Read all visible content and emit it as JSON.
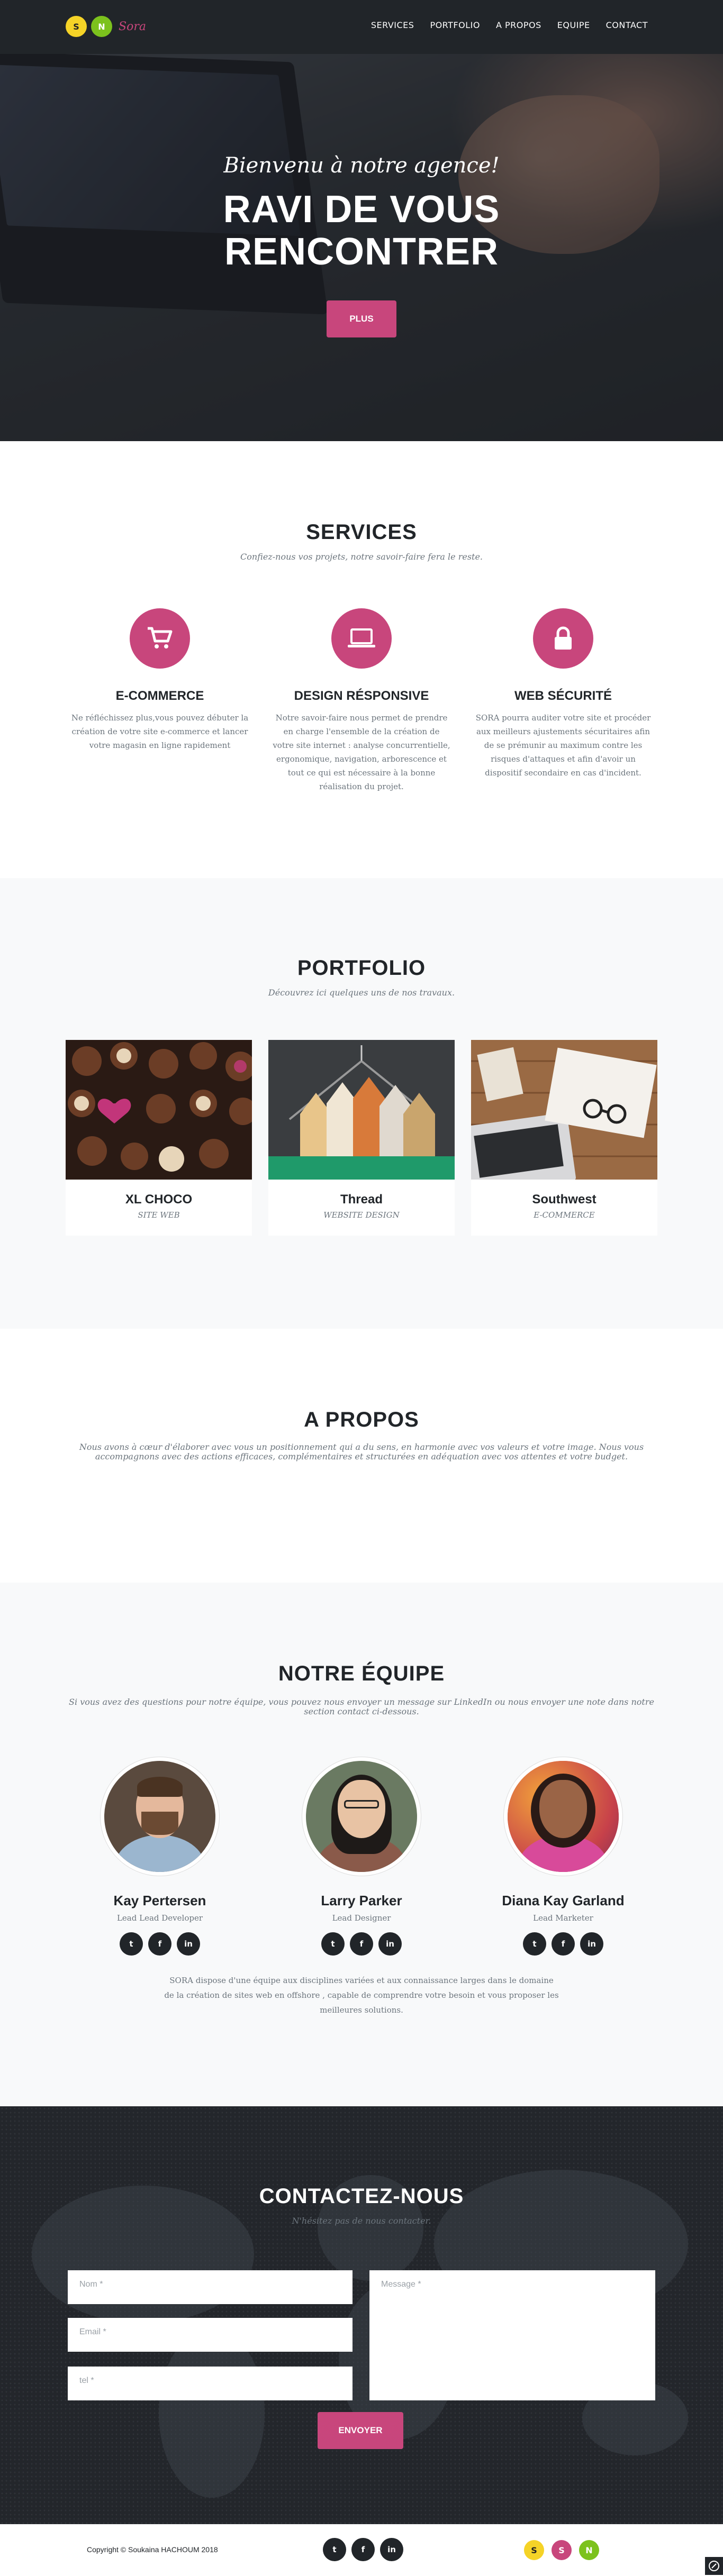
{
  "nav": {
    "brand_letters": [
      "S",
      "N"
    ],
    "brand_name": "Sora",
    "links": [
      "SERVICES",
      "PORTFOLIO",
      "A PROPOS",
      "EQUIPE",
      "CONTACT"
    ]
  },
  "hero": {
    "lead": "Bienvenu à notre agence!",
    "title_line1": "RAVI DE VOUS",
    "title_line2": "RENCONTRER",
    "button": "PLUS"
  },
  "services": {
    "heading": "SERVICES",
    "subheading": "Confiez-nous vos projets, notre savoir-faire fera le reste.",
    "items": [
      {
        "icon": "shopping-cart-icon",
        "title": "E-COMMERCE",
        "text": "Ne réfléchissez plus,vous pouvez débuter la création de votre site e-commerce et lancer votre magasin en ligne rapidement"
      },
      {
        "icon": "laptop-icon",
        "title": "DESIGN RÉSPONSIVE",
        "text": "Notre savoir-faire nous permet de prendre en charge l'ensemble de la création de votre site internet : analyse concurrentielle, ergonomique, navigation, arborescence et tout ce qui est nécessaire à la bonne réalisation du projet."
      },
      {
        "icon": "lock-icon",
        "title": "WEB SÉCURITÉ",
        "text": "SORA pourra auditer votre site et procéder aux meilleurs ajustements sécuritaires afin de se prémunir au maximum contre les risques d'attaques et afin d'avoir un dispositif secondaire en cas d'incident."
      }
    ]
  },
  "portfolio": {
    "heading": "PORTFOLIO",
    "subheading": "Découvrez ici quelques uns de nos travaux.",
    "items": [
      {
        "title": "XL CHOCO",
        "category": "SITE WEB"
      },
      {
        "title": "Thread",
        "category": "WEBSITE DESIGN"
      },
      {
        "title": "Southwest",
        "category": "E-COMMERCE"
      }
    ]
  },
  "about": {
    "heading": "A PROPOS",
    "text": "Nous avons à cœur d'élaborer avec vous un positionnement qui a du sens, en harmonie avec vos valeurs et votre image. Nous vous accompagnons avec des actions efficaces, complémentaires et structurées en adéquation avec vos attentes et votre budget."
  },
  "team": {
    "heading": "NOTRE ÉQUIPE",
    "subheading": "Si vous avez des questions pour notre équipe, vous pouvez nous envoyer un message sur LinkedIn ou nous envoyer une note dans notre section contact ci-dessous.",
    "members": [
      {
        "name": "Kay Pertersen",
        "role": "Lead Lead Developer"
      },
      {
        "name": "Larry Parker",
        "role": "Lead Designer"
      },
      {
        "name": "Diana Kay Garland",
        "role": "Lead Marketer"
      }
    ],
    "description": "SORA dispose d'une équipe aux disciplines variées et aux connaissance larges dans le domaine de la création de sites web en offshore , capable de comprendre votre besoin et vous proposer les meilleures solutions."
  },
  "social_glyphs": {
    "twitter": "t",
    "facebook": "f",
    "linkedin": "in"
  },
  "contact": {
    "heading": "CONTACTEZ-NOUS",
    "subheading": "N'hésitez pas de nous contacter.",
    "name_placeholder": "Nom *",
    "email_placeholder": "Email *",
    "tel_placeholder": "tel *",
    "message_placeholder": "Message *",
    "button": "ENVOYER"
  },
  "footer": {
    "copyright": "Copyright © Soukaina HACHOUM 2018",
    "dots": [
      "S",
      "S",
      "N"
    ]
  },
  "colors": {
    "accent": "#c8467c",
    "dark": "#212529",
    "yellow": "#f5d327",
    "green": "#7cc21d"
  }
}
